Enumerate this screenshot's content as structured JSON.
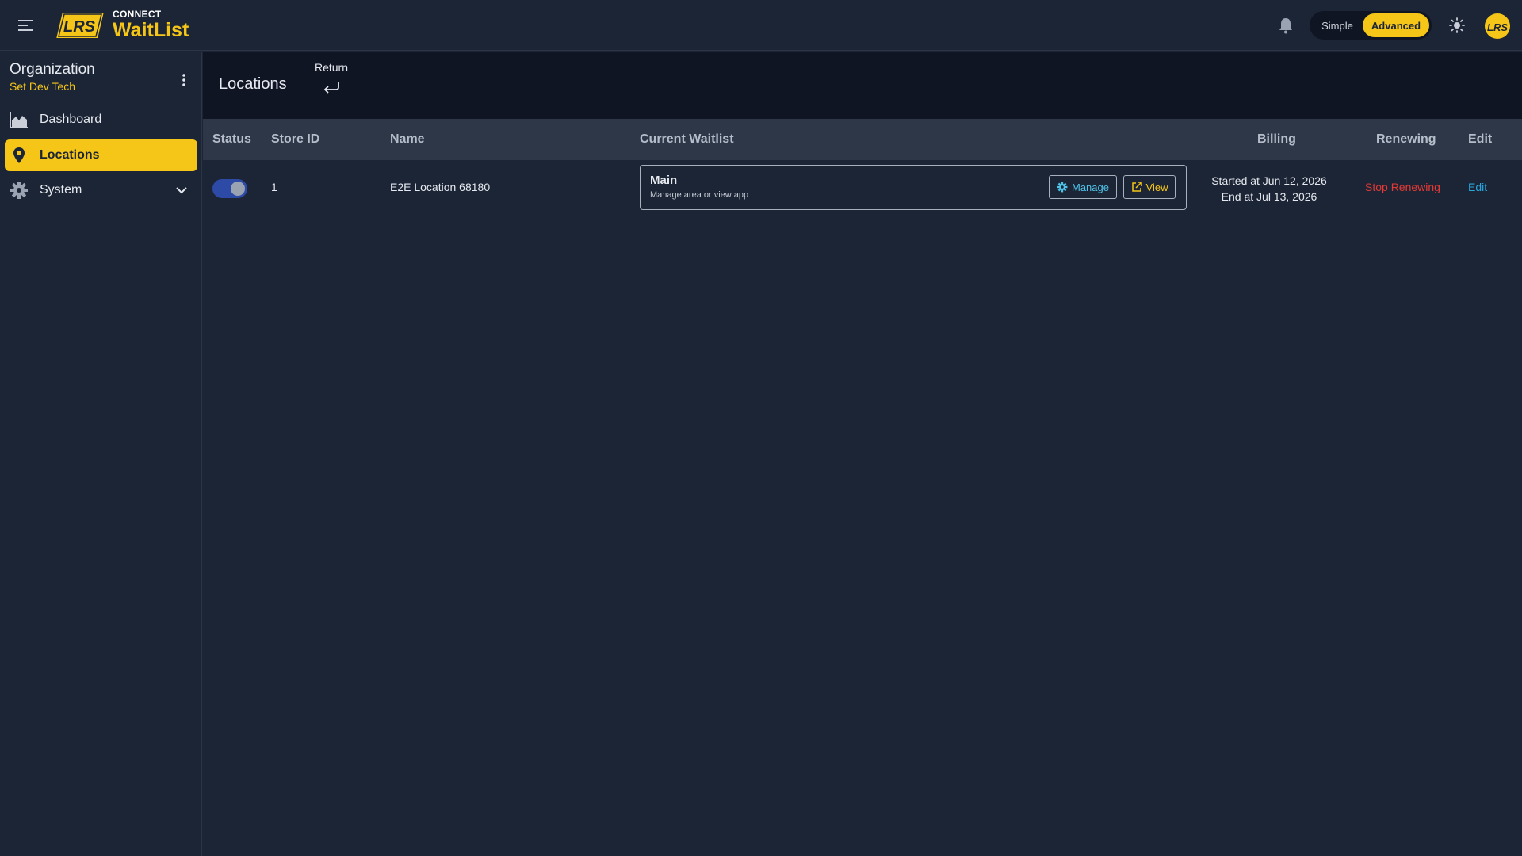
{
  "app": {
    "brand_small": "CONNECT",
    "brand_big": "WaitList",
    "logo_text": "LRS"
  },
  "topbar": {
    "mode_simple": "Simple",
    "mode_advanced": "Advanced",
    "mode_selected": "Advanced"
  },
  "sidebar": {
    "org_label": "Organization",
    "org_name": "Set Dev Tech",
    "items": [
      {
        "label": "Dashboard",
        "icon": "chart-area-icon"
      },
      {
        "label": "Locations",
        "icon": "map-pin-icon",
        "active": true
      },
      {
        "label": "System",
        "icon": "gear-icon",
        "expandable": true
      }
    ]
  },
  "header": {
    "title": "Locations",
    "return_label": "Return"
  },
  "table": {
    "columns": [
      "Status",
      "Store ID",
      "Name",
      "Current Waitlist",
      "Billing",
      "Renewing",
      "Edit"
    ],
    "rows": [
      {
        "status_on": true,
        "store_id": "1",
        "name": "E2E Location 68180",
        "waitlist_name": "Main",
        "waitlist_sub": "Manage area or view app",
        "manage_label": "Manage",
        "view_label": "View",
        "billing_start": "Started at Jun 12, 2026",
        "billing_end": "End at Jul 13, 2026",
        "renewing": "Stop Renewing",
        "edit": "Edit"
      }
    ]
  },
  "colors": {
    "accent": "#f5c518",
    "background": "#1c2535",
    "header_band": "#0f1523",
    "danger": "#e53935",
    "link": "#29a8e0"
  }
}
